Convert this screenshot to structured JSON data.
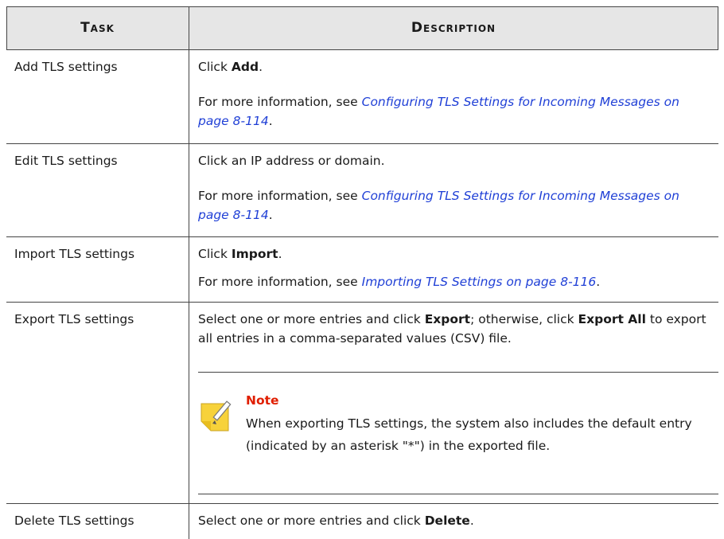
{
  "header": {
    "task": "Task",
    "description": "Description"
  },
  "rows": [
    {
      "task": "Add TLS settings",
      "line1": {
        "pre": "Click ",
        "bold": "Add",
        "post": "."
      },
      "more": {
        "pre": "For more information, see ",
        "link": "Configuring TLS Settings for Incoming Messages on page 8-114",
        "post": "."
      }
    },
    {
      "task": "Edit TLS settings",
      "line1": {
        "text": "Click an IP address or domain."
      },
      "more": {
        "pre": "For more information, see ",
        "link": "Configuring TLS Settings for Incoming Messages on page 8-114",
        "post": "."
      }
    },
    {
      "task": "Import TLS settings",
      "line1": {
        "pre": "Click ",
        "bold": "Import",
        "post": "."
      },
      "more": {
        "pre": "For more information, see ",
        "link": "Importing TLS Settings on page 8-116",
        "post": "."
      }
    },
    {
      "task": "Export TLS settings",
      "line1": {
        "pre": "Select one or more entries and click ",
        "bold": "Export",
        "mid": "; otherwise, click ",
        "bold2": "Export All",
        "post": " to export all entries in a comma-separated values (CSV) file."
      },
      "note": {
        "icon": "note-pencil-icon",
        "title": "Note",
        "text": "When exporting TLS settings, the system also includes the default entry (indicated by an asterisk \"*\") in the exported file."
      }
    },
    {
      "task": "Delete TLS settings",
      "line1": {
        "pre": "Select one or more entries and click ",
        "bold": "Delete",
        "post": "."
      }
    }
  ],
  "colors": {
    "header_bg": "#e6e6e6",
    "link": "#1f3fd6",
    "note_title": "#e01e00",
    "border": "#444444"
  }
}
